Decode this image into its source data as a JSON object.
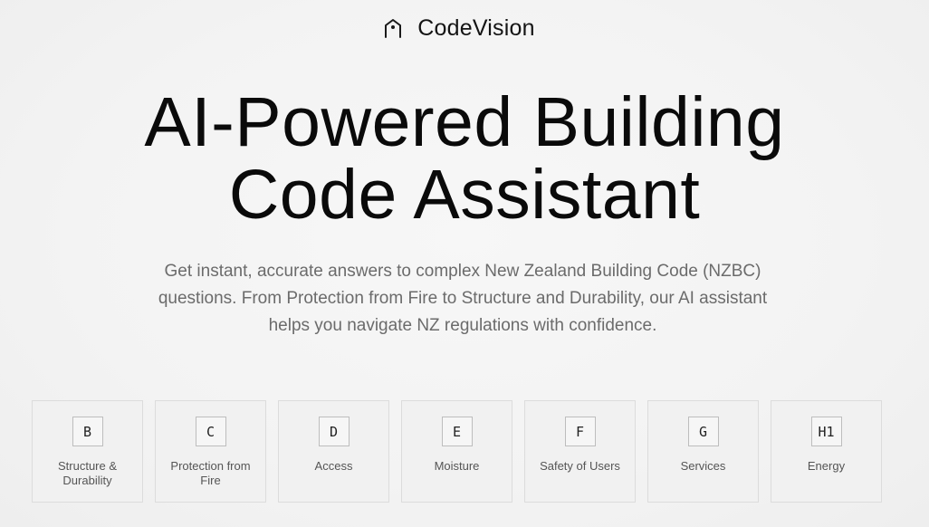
{
  "brand": {
    "name": "CodeVision",
    "icon": "building-pin-icon"
  },
  "hero": {
    "title_line1": "AI-Powered Building",
    "title_line2": "Code Assistant",
    "subtitle": "Get instant, accurate answers to complex New Zealand Building Code (NZBC) questions. From Protection from Fire to Structure and Durability, our AI assistant helps you navigate NZ regulations with confidence."
  },
  "categories": [
    {
      "code": "B",
      "label": "Structure & Durability"
    },
    {
      "code": "C",
      "label": "Protection from Fire"
    },
    {
      "code": "D",
      "label": "Access"
    },
    {
      "code": "E",
      "label": "Moisture"
    },
    {
      "code": "F",
      "label": "Safety of Users"
    },
    {
      "code": "G",
      "label": "Services"
    },
    {
      "code": "H1",
      "label": "Energy"
    }
  ]
}
